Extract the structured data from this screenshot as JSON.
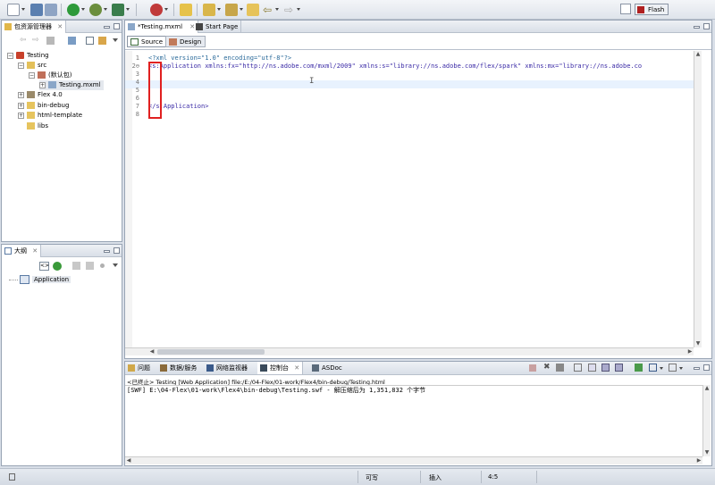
{
  "toolbar": {
    "perspective_label": "Flash"
  },
  "package_explorer": {
    "tab_label": "包资源管理器",
    "tree": [
      {
        "label": "Testing"
      },
      {
        "label": "src"
      },
      {
        "label": "(默认包)"
      },
      {
        "label": "Testing.mxml"
      },
      {
        "label": "Flex 4.0"
      },
      {
        "label": "bin-debug"
      },
      {
        "label": "html-template"
      },
      {
        "label": "libs"
      }
    ]
  },
  "outline": {
    "tab_label": "大纲",
    "items": [
      {
        "label": "Application"
      }
    ]
  },
  "editor": {
    "tabs": [
      {
        "label": "*Testing.mxml"
      },
      {
        "label": "Start Page"
      }
    ],
    "mode_source": "Source",
    "mode_design": "Design",
    "line_numbers": [
      "1",
      "2⊖",
      "3",
      "4",
      "5",
      "6",
      "7",
      "8"
    ],
    "lines": [
      "<?xml version=\"1.0\" encoding=\"utf-8\"?>",
      "<s:Application xmlns:fx=\"http://ns.adobe.com/mxml/2009\" xmlns:s=\"library://ns.adobe.com/flex/spark\" xmlns:mx=\"library://ns.adobe.co",
      "",
      "",
      "",
      "",
      "</s:Application>",
      ""
    ]
  },
  "console": {
    "tabs": [
      {
        "label": "问题"
      },
      {
        "label": "数据/服务"
      },
      {
        "label": "网络监视器"
      },
      {
        "label": "控制台"
      },
      {
        "label": "ASDoc"
      }
    ],
    "header": "<已终止> Testing [Web Application] file:/E:/04-Flex/01-work/Flex4/bin-debug/Testing.html",
    "output": "[SWF] E:\\04-Flex\\01-work\\Flex4\\bin-debug\\Testing.swf - 解压缩后为 1,351,832 个字节"
  },
  "statusbar": {
    "writable": "可写",
    "insert_mode": "插入",
    "position": "4:5"
  }
}
